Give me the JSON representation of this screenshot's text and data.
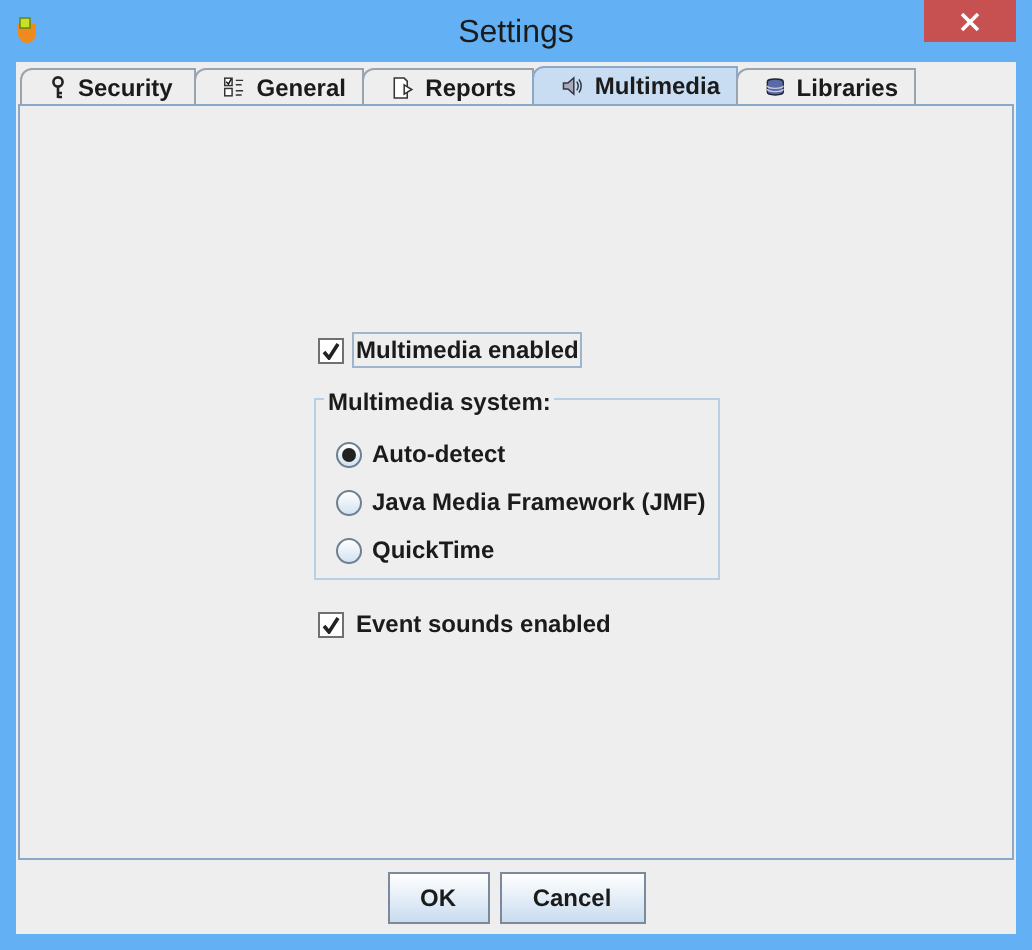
{
  "window": {
    "title": "Settings"
  },
  "tabs": [
    {
      "label": "Security",
      "selected": false,
      "kind": "key"
    },
    {
      "label": "General",
      "selected": false,
      "kind": "list"
    },
    {
      "label": "Reports",
      "selected": false,
      "kind": "report"
    },
    {
      "label": "Multimedia",
      "selected": true,
      "kind": "speaker"
    },
    {
      "label": "Libraries",
      "selected": false,
      "kind": "database"
    }
  ],
  "multimedia_enabled": {
    "label": "Multimedia enabled",
    "checked": true
  },
  "multimedia_system": {
    "legend": "Multimedia system:",
    "options": [
      {
        "label": "Auto-detect",
        "selected": true
      },
      {
        "label": "Java Media Framework (JMF)",
        "selected": false
      },
      {
        "label": "QuickTime",
        "selected": false
      }
    ]
  },
  "event_sounds": {
    "label": "Event sounds enabled",
    "checked": true
  },
  "buttons": [
    "OK",
    "Cancel"
  ]
}
